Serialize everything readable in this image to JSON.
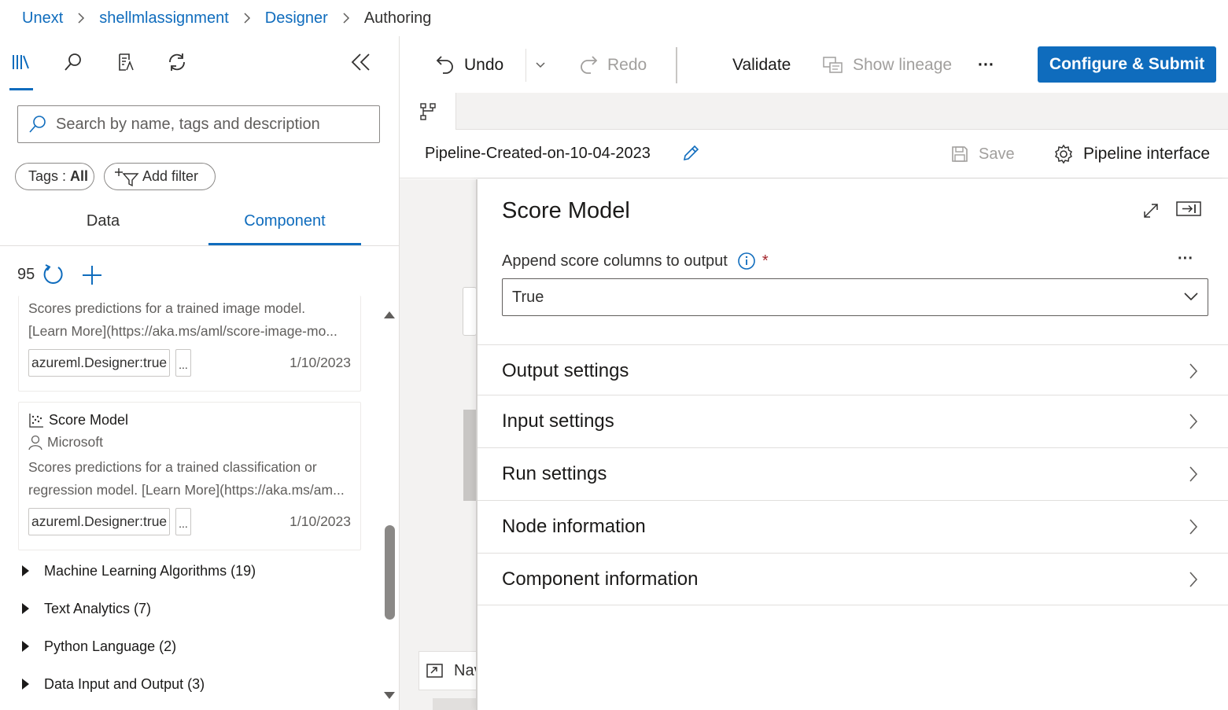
{
  "breadcrumb": {
    "items": [
      "Unext",
      "shellmlassignment",
      "Designer"
    ],
    "current": "Authoring"
  },
  "left_panel": {
    "toolbar_icons": [
      "library-icon",
      "search-icon",
      "document-icon",
      "refresh-icon"
    ],
    "collapse_icon": "double-chevron-left-icon",
    "search": {
      "placeholder": "Search by name, tags and description",
      "value": ""
    },
    "tags_filter": {
      "label": "Tags : ",
      "value": "All"
    },
    "add_filter_label": "Add filter",
    "tabs": [
      {
        "label": "Data",
        "active": false
      },
      {
        "label": "Component",
        "active": true
      }
    ],
    "component_count": "95",
    "cards": [
      {
        "desc_lines": [
          "Scores predictions for a trained image model.",
          "[Learn More](https://aka.ms/aml/score-image-mo..."
        ],
        "tag": "azureml.Designer:true",
        "more": "...",
        "date": "1/10/2023"
      },
      {
        "title": "Score Model",
        "author": "Microsoft",
        "desc_lines": [
          "Scores predictions for a trained classification or",
          "regression model. [Learn More](https://aka.ms/am..."
        ],
        "tag": "azureml.Designer:true",
        "more": "...",
        "date": "1/10/2023"
      }
    ],
    "categories": [
      "Machine Learning Algorithms (19)",
      "Text Analytics (7)",
      "Python Language (2)",
      "Data Input and Output (3)"
    ]
  },
  "commands": {
    "undo": "Undo",
    "redo": "Redo",
    "validate": "Validate",
    "show_lineage": "Show lineage",
    "more": "···",
    "submit": "Configure & Submit"
  },
  "pipeline": {
    "name": "Pipeline-Created-on-10-04-2023",
    "save": "Save",
    "interface": "Pipeline interface"
  },
  "canvas": {
    "nav_label": "Navigator"
  },
  "details_panel": {
    "title": "Score Model",
    "field_label": "Append score columns to output",
    "required_mark": "*",
    "field_value": "True",
    "more": "···",
    "sections": [
      "Output settings",
      "Input settings",
      "Run settings",
      "Node information",
      "Component information"
    ]
  },
  "colors": {
    "accent": "#0f6cbd",
    "required": "#a4262c",
    "canvas_bg": "#f3f2f1"
  }
}
